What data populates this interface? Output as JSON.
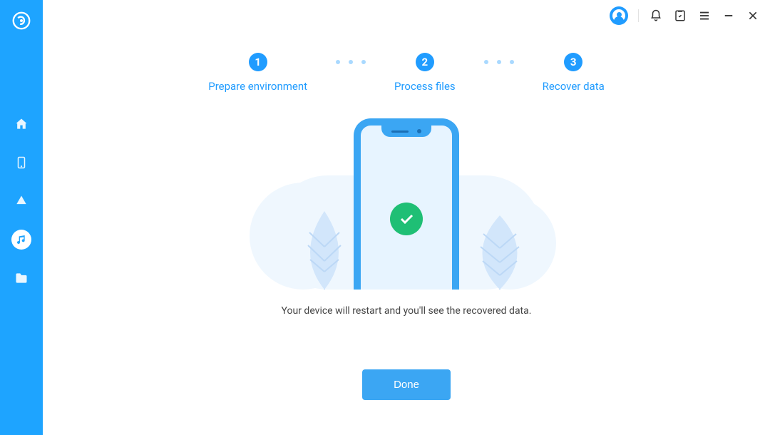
{
  "titlebar": {
    "icons": [
      "account",
      "bell",
      "task",
      "menu",
      "minimize",
      "close"
    ]
  },
  "sidebar": {
    "items": [
      {
        "name": "home",
        "active": false
      },
      {
        "name": "phone",
        "active": false
      },
      {
        "name": "cloud",
        "active": false
      },
      {
        "name": "music",
        "active": true
      },
      {
        "name": "folder",
        "active": false
      }
    ]
  },
  "steps": [
    {
      "num": "1",
      "label": "Prepare environment"
    },
    {
      "num": "2",
      "label": "Process files"
    },
    {
      "num": "3",
      "label": "Recover data"
    }
  ],
  "main": {
    "message": "Your device will restart and you'll see the recovered data.",
    "button": "Done"
  },
  "colors": {
    "primary": "#1ea4ff",
    "accent": "#3ba6f3",
    "success": "#1fbf75"
  }
}
